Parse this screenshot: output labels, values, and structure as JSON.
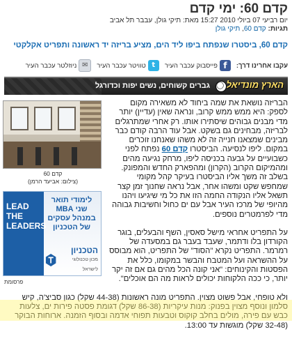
{
  "article": {
    "title": "קדם 60: ימי קדם",
    "meta": "יום רביעי 07 ביולי 2010 15:27 מאת: תיקי גולן, עבבר תל אביב",
    "tags_label": "תגיות:",
    "tags": [
      "קדם 60",
      "תיקי גולן"
    ],
    "subhead": "קדם 60, ביסטרו שנפתח ביפו ליד הים, מציע בריזה יד ראשונה ותפריט אקלקטי"
  },
  "follow": {
    "label": "עקבו אחרינו דרך:",
    "facebook": "פייסבוק עכבר העיר",
    "twitter": "טוויטר עכבר העיר",
    "newsletter": "ניוזלטר עכבר העיר"
  },
  "section": {
    "logo": "הארץ מונדיאל",
    "slogan": "גברים קשוחים, נשים יפות וכדורגל"
  },
  "photo": {
    "title": "קדם 60",
    "credit": "(צילום: אביעד הרמן)"
  },
  "ad": {
    "lead": "LEAD THE LEADERS",
    "headline": "לימודי תואר שני MBA במנהל עסקים של הטכניון",
    "brand": "הטכניון",
    "brand_sub": "מכון טכנולוגי לישראל",
    "label": "פרסומת"
  },
  "body": {
    "p1": "הבריזה נושאת את שמה ביחוד לא משאירה מקום לספק: היא ממש ממש קרוב, ונראה שאין (עדיין) יותר מדי מבנים גבוהים שיסתירו אותו. רק אחרי שמתרגלים לבריזה, מבחינים גם בשקט. אבל עוד הרבה קודם כבר מבינים שמצאנו חנייה זה לא משהו שאנחנו זוכרים במקום. ליפו לנסיעה. הביסטרו",
    "p1_link": "קדם 60",
    "p1_rest": "נפתח לפני כשבועיים על גבעה בכניסה ליפו, מרחק נגיעה מהים ומהמיקום הקרוב (הקרון) ומהפארק החדש והמפונק. בשלב זה משך אליו הביסטרו בעיקר קהל מקומי שמחפש שקט ומשהו אחר, אבל נראה שחנוך זמן קצר תשאל אליו הנקודה החמה הזו את כל מי שיגיעו ויהנו מהיופי של מרכז העיר אבל עם ים כחול וחשיבות גבוהה מדי לפרמטרים נוספים.",
    "p2": "על התפריט אחראי מישל סאסין, השף והבעלים, בוגר הקורדון בלו ודתמר, שעבד בעבר גם במסעדה של רמרמר. התפריט נקרא \"הסוד\" של התפריט, הוא מבוסס על ההשראה ועל המטבח והבשר במקומו, כלל את הפסטות והקינוחים: \"אני קונה הכל מהים גם אם זה יקר יותר, כי ככה הלקוחות יכולים לראות מה הם אוכלים\".",
    "p3": "ולא טופחי, אבל פשוט מצוין. התפריט מונה ראשונות (44-38 שקל) כגון סביצ'ה, קיש סלמון ונוסף מצוין בפנוק: מנות עיקריות (86-38 שקל) דגומת פסטה פירות ים, צלעות כבש עם פירה, מולים בחלב קוקוס וטבעות תפוחי אדמה ובסוף הזמנה. ארוחות הבוקר (32-48 שקל) מוגשות עד 13:00."
  }
}
